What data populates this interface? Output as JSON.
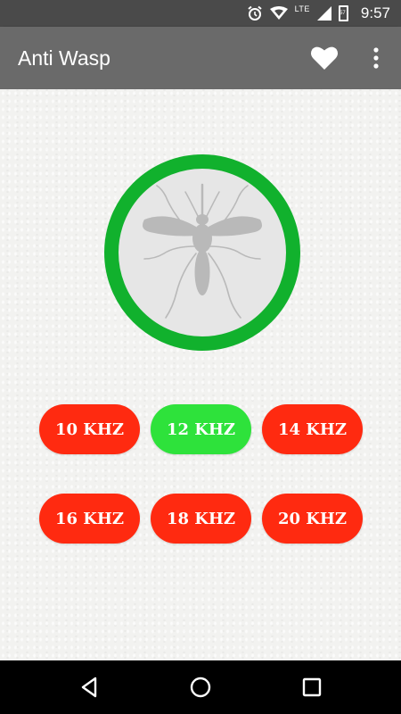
{
  "status_bar": {
    "network_type": "LTE",
    "battery_level": "57",
    "time": "9:57",
    "icons": [
      "alarm-icon",
      "signal-icon",
      "battery-icon"
    ]
  },
  "app_bar": {
    "title": "Anti Wasp",
    "actions": [
      "heart-icon",
      "overflow-menu-icon"
    ]
  },
  "main": {
    "toggle": {
      "state": "on",
      "ring_color": "#11b12d",
      "icon": "mosquito-icon"
    },
    "frequency_buttons": [
      {
        "label": "10 KHZ",
        "selected": false
      },
      {
        "label": "12 KHZ",
        "selected": true
      },
      {
        "label": "14 KHZ",
        "selected": false
      },
      {
        "label": "16 KHZ",
        "selected": false
      },
      {
        "label": "18 KHZ",
        "selected": false
      },
      {
        "label": "20 KHZ",
        "selected": false
      }
    ],
    "colors": {
      "selected": "#2ee23b",
      "unselected": "#ff2a10"
    }
  },
  "nav_bar": {
    "buttons": [
      "back-icon",
      "home-icon",
      "recents-icon"
    ]
  }
}
